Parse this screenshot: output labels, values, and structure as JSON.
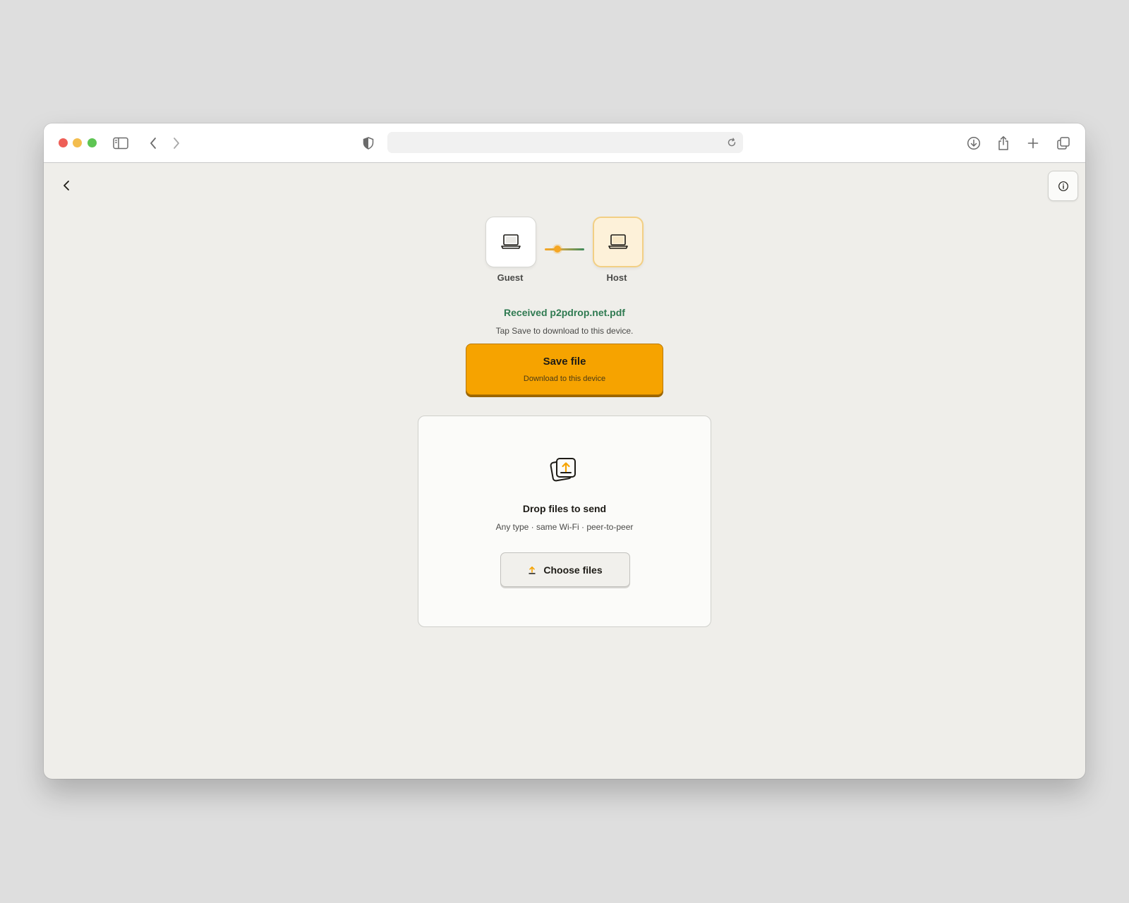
{
  "browser": {
    "address_value": "",
    "icons": [
      "sidebar-icon",
      "back-icon",
      "forward-icon",
      "shield-icon",
      "reload-icon",
      "download-icon",
      "share-icon",
      "plus-icon",
      "tabs-icon"
    ]
  },
  "page": {
    "back_icon": "chevron-left-icon",
    "info_icon": "info-icon",
    "devices": {
      "guest_label": "Guest",
      "host_label": "Host"
    },
    "received_text": "Received p2pdrop.net.pdf",
    "hint_text": "Tap Save to download to this device.",
    "save_button": {
      "title": "Save file",
      "subtitle": "Download to this device"
    },
    "drop_zone": {
      "title": "Drop files to send",
      "subtitle": "Any type · same Wi-Fi · peer-to-peer",
      "choose_label": "Choose files"
    }
  },
  "colors": {
    "accent": "#f6a300",
    "success": "#2f7a51",
    "page_bg": "#efeeea"
  }
}
